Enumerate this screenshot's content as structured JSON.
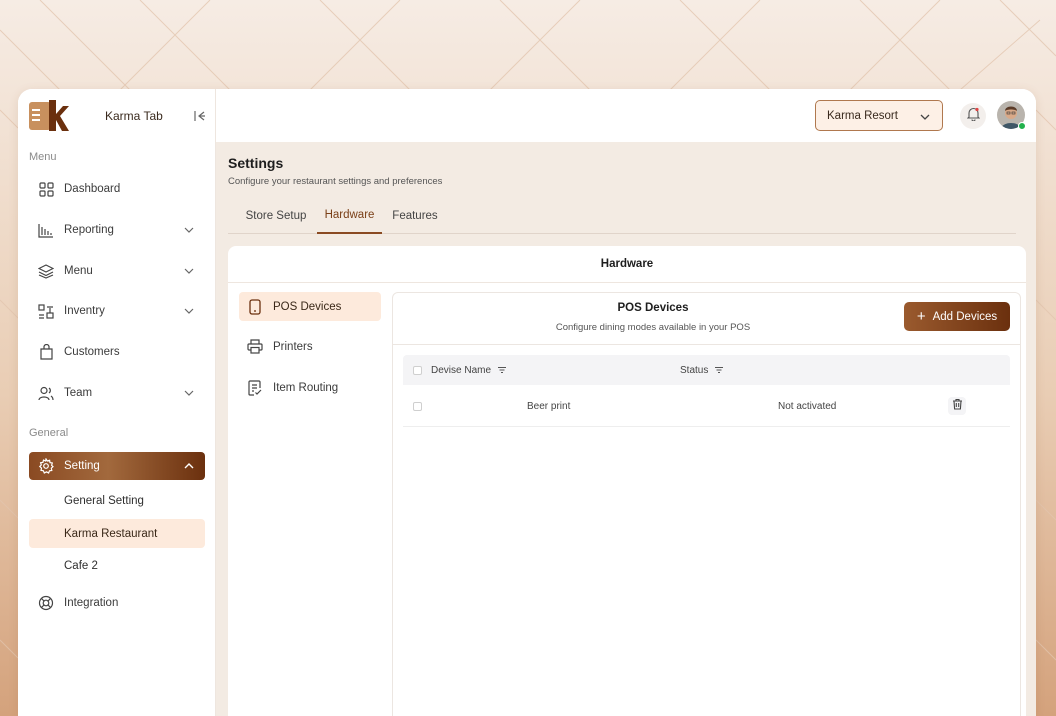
{
  "sidebar": {
    "brand_name": "Karma Tab",
    "menu_label": "Menu",
    "general_label": "General",
    "items": [
      {
        "label": "Dashboard",
        "icon": "grid-icon"
      },
      {
        "label": "Reporting",
        "icon": "bar-chart-icon"
      },
      {
        "label": "Menu",
        "icon": "layers-icon"
      },
      {
        "label": "Inventry",
        "icon": "inventory-icon"
      },
      {
        "label": "Customers",
        "icon": "shopping-bag-icon"
      },
      {
        "label": "Team",
        "icon": "users-icon"
      }
    ],
    "setting": {
      "label": "Setting",
      "icon": "gear-icon",
      "sub_items": [
        "General Setting",
        "Karma Restaurant",
        "Cafe 2"
      ],
      "selected": "Karma Restaurant"
    },
    "integration": {
      "label": "Integration",
      "icon": "lifebuoy-icon"
    }
  },
  "topbar": {
    "location_select": "Karma Resort",
    "bell_icon": "bell-icon"
  },
  "page": {
    "title": "Settings",
    "subtitle": "Configure your restaurant settings and preferences",
    "tabs": [
      "Store Setup",
      "Hardware",
      "Features"
    ],
    "active_tab": "Hardware"
  },
  "hardware": {
    "card_title": "Hardware",
    "menu": [
      {
        "label": "POS Devices",
        "icon": "tablet-icon"
      },
      {
        "label": "Printers",
        "icon": "printer-icon"
      },
      {
        "label": "Item Routing",
        "icon": "routing-icon"
      }
    ],
    "active": "POS Devices",
    "panel_title": "POS Devices",
    "panel_subtitle": "Configure dining modes available in your POS",
    "add_button": "Add Devices",
    "table": {
      "columns": [
        "Devise Name",
        "Status"
      ],
      "rows": [
        {
          "name": "Beer print",
          "status": "Not activated"
        }
      ]
    }
  },
  "colors": {
    "accent": "#8a4a22",
    "accent_light": "#fdeadc",
    "content_bg": "#f3ebe3",
    "online": "#22b14c"
  }
}
